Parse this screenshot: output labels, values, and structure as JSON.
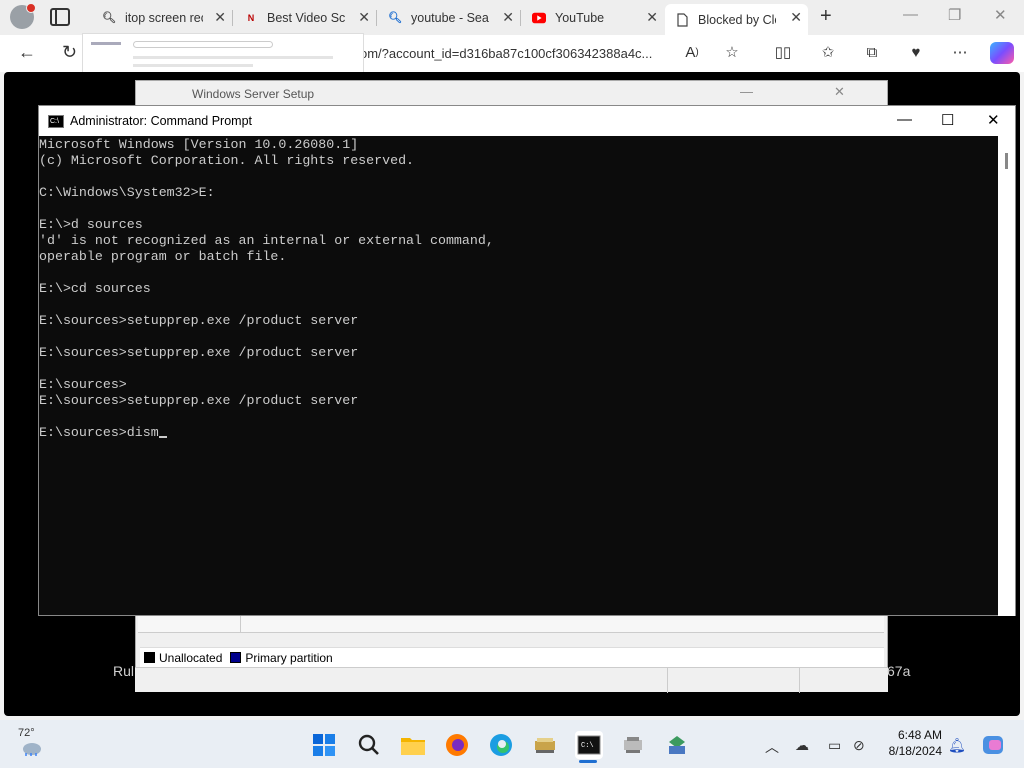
{
  "browser": {
    "tabs": [
      {
        "label": "itop screen rec",
        "icon": "search-icon"
      },
      {
        "label": "Best Video Scr",
        "icon": "nch-logo-icon"
      },
      {
        "label": "youtube - Sear",
        "icon": "search-icon"
      },
      {
        "label": "YouTube",
        "icon": "youtube-icon"
      },
      {
        "label": "Blocked by Clo",
        "icon": "page-icon",
        "active": true
      }
    ],
    "address": "om/?account_id=d316ba87c100cf306342388a4c...",
    "colors": {
      "accent": "#1f6fd1",
      "youtube": "#ff0000"
    }
  },
  "background_window": {
    "title": "Windows Server Setup",
    "legend": [
      {
        "label": "Unallocated",
        "color": "#000000"
      },
      {
        "label": "Primary partition",
        "color": "#00008b"
      }
    ],
    "left_fragment": "Rul",
    "right_fragment": "67a"
  },
  "cmd": {
    "title": "Administrator: Command Prompt",
    "icon_text": "C:\\",
    "lines": [
      "Microsoft Windows [Version 10.0.26080.1]",
      "(c) Microsoft Corporation. All rights reserved.",
      "",
      "C:\\Windows\\System32>E:",
      "",
      "E:\\>d sources",
      "'d' is not recognized as an internal or external command,",
      "operable program or batch file.",
      "",
      "E:\\>cd sources",
      "",
      "E:\\sources>setupprep.exe /product server",
      "",
      "E:\\sources>setupprep.exe /product server",
      "",
      "E:\\sources>",
      "E:\\sources>setupprep.exe /product server",
      "",
      "E:\\sources>dism"
    ]
  },
  "taskbar": {
    "weather": "72°",
    "time": "6:48 AM",
    "date": "8/18/2024"
  }
}
